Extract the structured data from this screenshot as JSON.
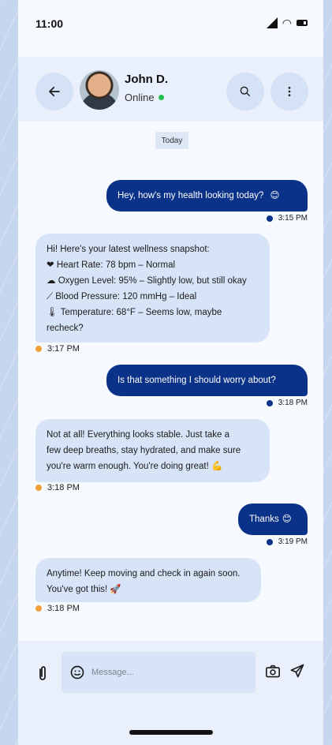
{
  "status_bar": {
    "time": "11:00"
  },
  "header": {
    "contact_name": "John D.",
    "contact_status": "Online"
  },
  "chat": {
    "date_chip": "Today",
    "messages": [
      {
        "direction": "out",
        "text": "Hey, how's my health looking today?",
        "emoji": "😊",
        "time": "3:15 PM"
      },
      {
        "direction": "in",
        "lines": [
          "Hi! Here's your latest wellness snapshot:",
          "❤ Heart Rate: 78 bpm – Normal",
          "☁ Oxygen Level: 95% – Slightly low, but still okay",
          "⟋ Blood Pressure: 120 mmHg – Ideal",
          "🌡 Temperature: 68°F – Seems low, maybe",
          "recheck?"
        ],
        "time": "3:17 PM"
      },
      {
        "direction": "out",
        "text": "Is that something I should worry about?",
        "time": "3:18 PM"
      },
      {
        "direction": "in",
        "lines": [
          "Not at all! Everything looks stable. Just take a",
          "few deep breaths, stay hydrated, and make sure",
          "you're warm enough. You're doing great! 💪"
        ],
        "time": "3:18 PM"
      },
      {
        "direction": "out",
        "text": "Thanks",
        "emoji": "😊",
        "time": "3:19 PM"
      },
      {
        "direction": "in",
        "lines": [
          "Anytime! Keep moving and check in again soon.",
          "You've got this! 🚀"
        ],
        "time": "3:18 PM"
      }
    ]
  },
  "composer": {
    "placeholder": "Message..."
  },
  "icons": {
    "back": "arrow-left-icon",
    "search": "search-icon",
    "more": "more-vertical-icon",
    "attach": "paperclip-icon",
    "emoji": "smiley-icon",
    "camera": "camera-icon",
    "send": "send-icon"
  },
  "colors": {
    "outgoing_bubble": "#0a3288",
    "incoming_bubble": "#d7e4f8",
    "online": "#1fbf4d",
    "incoming_dot": "#f1a03c"
  }
}
